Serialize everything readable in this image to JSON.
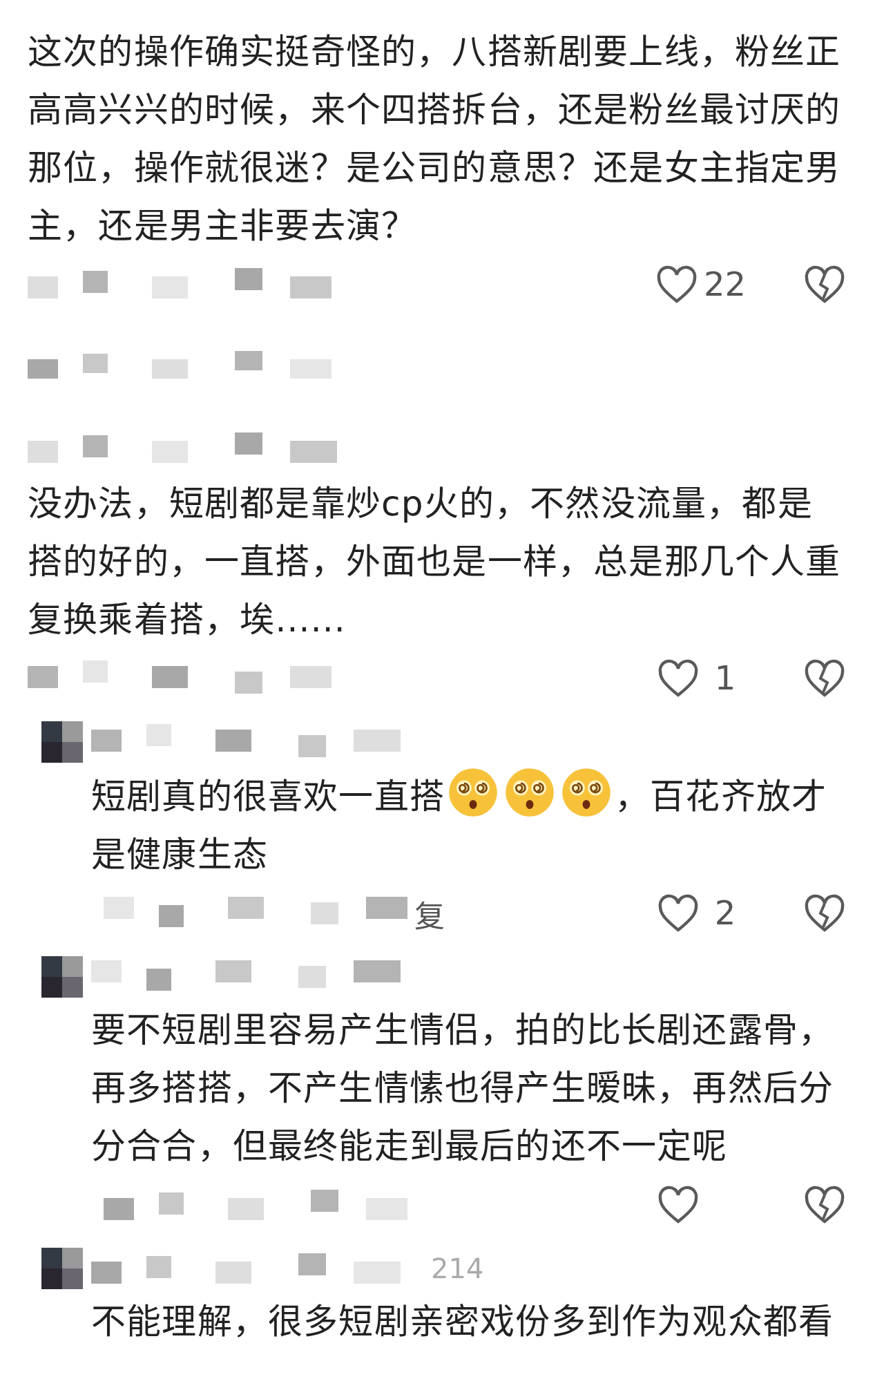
{
  "comments": [
    {
      "kind": "comment",
      "parts": [
        {
          "kind": "text",
          "text": "这次的操作确实挺奇怪的，八搭新剧要上线，粉丝正高高兴兴的时候，来个四搭拆台，还是粉丝最讨厌的那位，操作就很迷？是公司的意思？还是女主指定男主，还是男主非要去演？"
        }
      ],
      "likes": "22",
      "header": false
    },
    {
      "kind": "comment",
      "parts": [
        {
          "kind": "text",
          "text": "没办法，短剧都是靠炒cp火的，不然没流量，都是搭的好的，一直搭，外面也是一样，总是那几个人重复换乘着搭，埃......"
        }
      ],
      "likes": "1",
      "header": true
    },
    {
      "kind": "reply",
      "parts": [
        {
          "kind": "text",
          "text": "短剧真的很喜欢一直搭"
        },
        {
          "kind": "emoji"
        },
        {
          "kind": "emoji"
        },
        {
          "kind": "emoji"
        },
        {
          "kind": "text",
          "text": "，百花齐放才是健康生态"
        }
      ],
      "likes": "2",
      "meta": "复",
      "header": true
    },
    {
      "kind": "reply",
      "parts": [
        {
          "kind": "text",
          "text": "要不短剧里容易产生情侣，拍的比长剧还露骨，再多搭搭，不产生情愫也得产生暧昧，再然后分分合合，但最终能走到最后的还不一定呢"
        }
      ],
      "header": true
    },
    {
      "kind": "reply",
      "parts": [
        {
          "kind": "text",
          "text": "不能理解，很多短剧亲密戏份多到作为观众都看"
        }
      ],
      "header_meta": "214",
      "header": true,
      "footer": false
    }
  ]
}
